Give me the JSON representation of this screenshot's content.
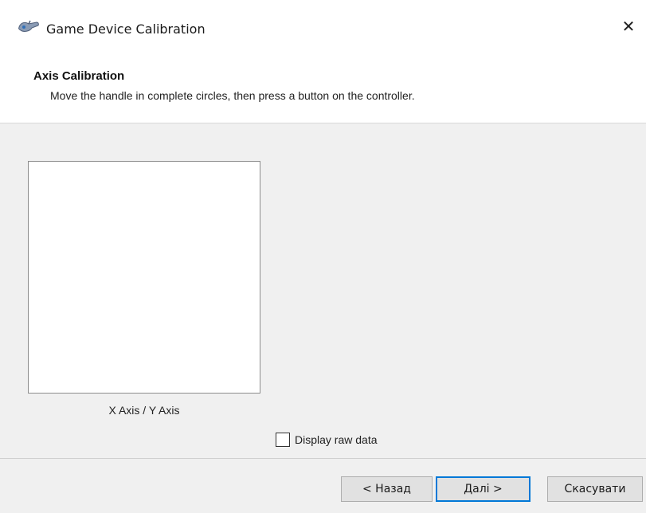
{
  "window": {
    "title": "Game Device Calibration",
    "icon": "joystick-icon",
    "close_label": "✕"
  },
  "header": {
    "heading": "Axis Calibration",
    "description": "Move the handle in complete circles, then press a button on the controller."
  },
  "calibration": {
    "axis_label": "X Axis / Y Axis"
  },
  "options": {
    "raw_data_label": "Display raw data",
    "raw_data_checked": false
  },
  "buttons": {
    "back_label": "< Назад",
    "next_label": "Далі >",
    "cancel_label": "Скасувати"
  },
  "colors": {
    "accent": "#0078d7",
    "body_background": "#f0f0f0"
  }
}
